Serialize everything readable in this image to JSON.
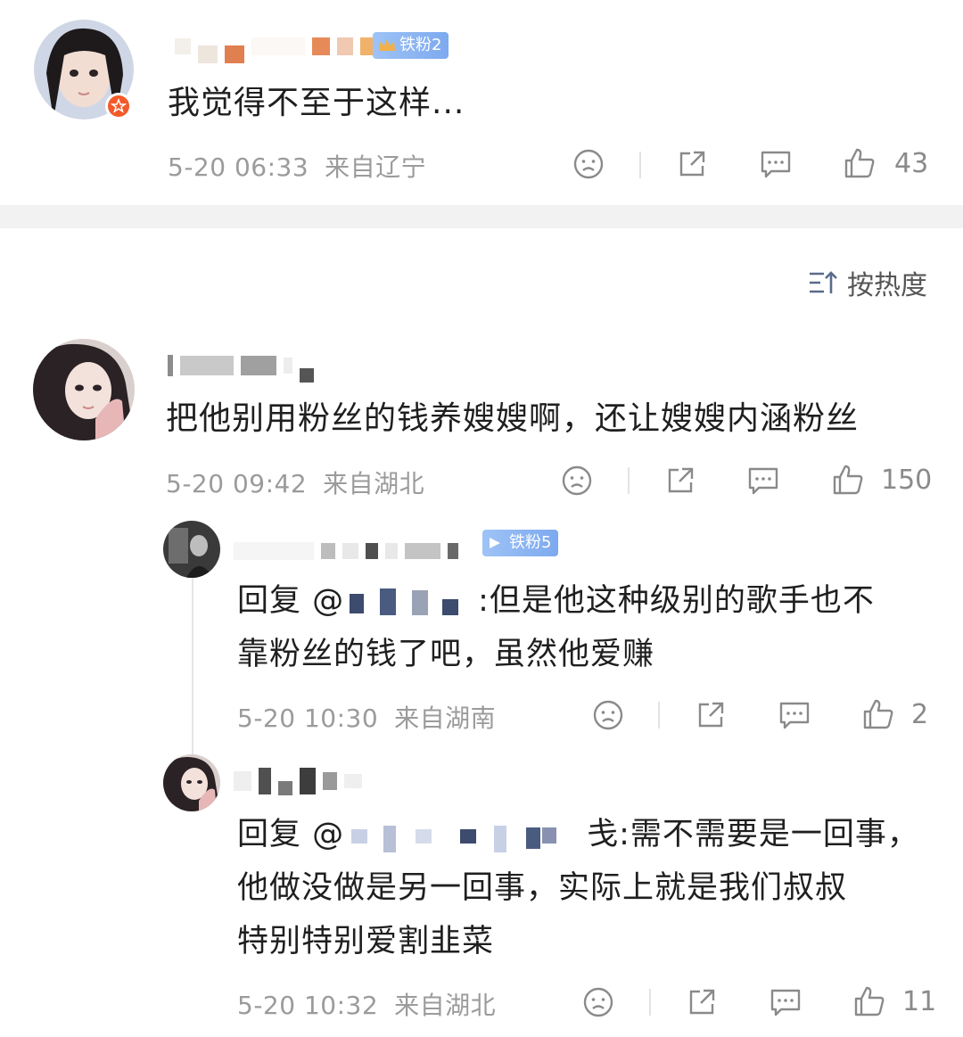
{
  "comments": [
    {
      "author_badge": "铁粉2",
      "text": "我觉得不至于这样...",
      "date": "5-20 06:33",
      "location": "来自辽宁",
      "likes": "43"
    },
    {
      "text": "把他别用粉丝的钱养嫂嫂啊，还让嫂嫂内涵粉丝",
      "date": "5-20 09:42",
      "location": "来自湖北",
      "likes": "150",
      "replies": [
        {
          "author_badge": "铁粉5",
          "reply_prefix": "回复 @",
          "text_line1": ":但是他这种级别的歌手也不",
          "text_line2": "靠粉丝的钱了吧，虽然他爱赚",
          "date": "5-20 10:30",
          "location": "来自湖南",
          "likes": "2"
        },
        {
          "reply_prefix": "回复 @",
          "text_line1": "戋:需不需要是一回事，",
          "text_line2": "他做没做是另一回事，实际上就是我们叔叔",
          "text_line3": "特别特别爱割韭菜",
          "date": "5-20 10:32",
          "location": "来自湖北",
          "likes": "11"
        }
      ]
    }
  ],
  "sort": {
    "label": "按热度"
  },
  "icons": {
    "dislike": "frown-face-icon",
    "share": "share-icon",
    "comment": "comment-bubble-icon",
    "like": "thumbs-up-icon",
    "sort": "sort-icon"
  },
  "colors": {
    "badge_gradient_start": "#9ec3f6",
    "badge_gradient_end": "#7da9ef",
    "vip_badge": "#f25a2a",
    "meta_text": "#9b9b9b",
    "separator": "#f2f2f2"
  }
}
